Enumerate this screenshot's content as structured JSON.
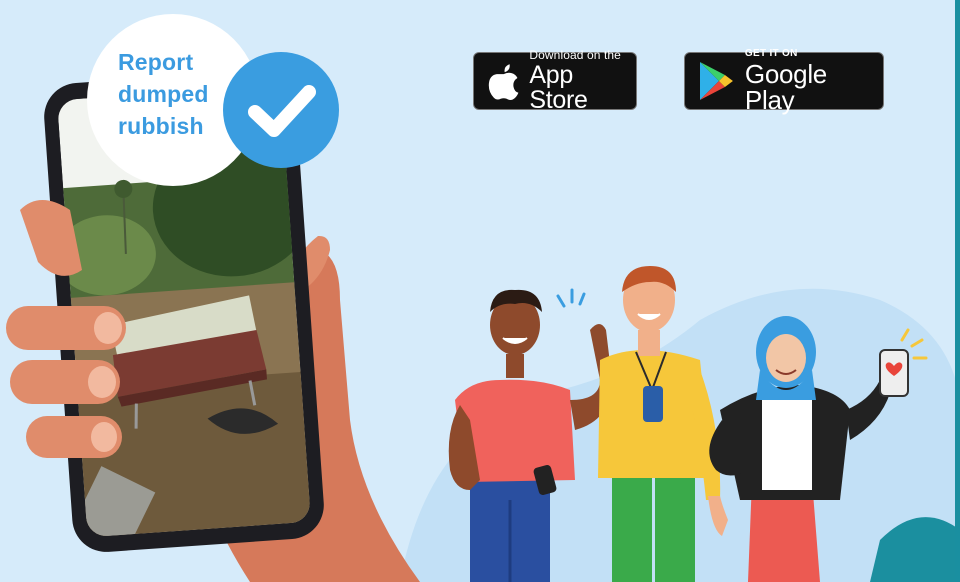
{
  "callout": {
    "text": "Report\ndumped\nrubbish"
  },
  "badges": {
    "app_store": {
      "small": "Download on the",
      "big": "App Store"
    },
    "google_play": {
      "small": "GET IT ON",
      "big": "Google Play"
    }
  },
  "colors": {
    "background": "#d6ebfa",
    "accent_blue": "#3a9de0",
    "badge_black": "#111111",
    "edge_teal": "#1a8fa0"
  },
  "icons": [
    "apple-logo-icon",
    "google-play-icon",
    "checkmark-icon",
    "heart-icon"
  ]
}
